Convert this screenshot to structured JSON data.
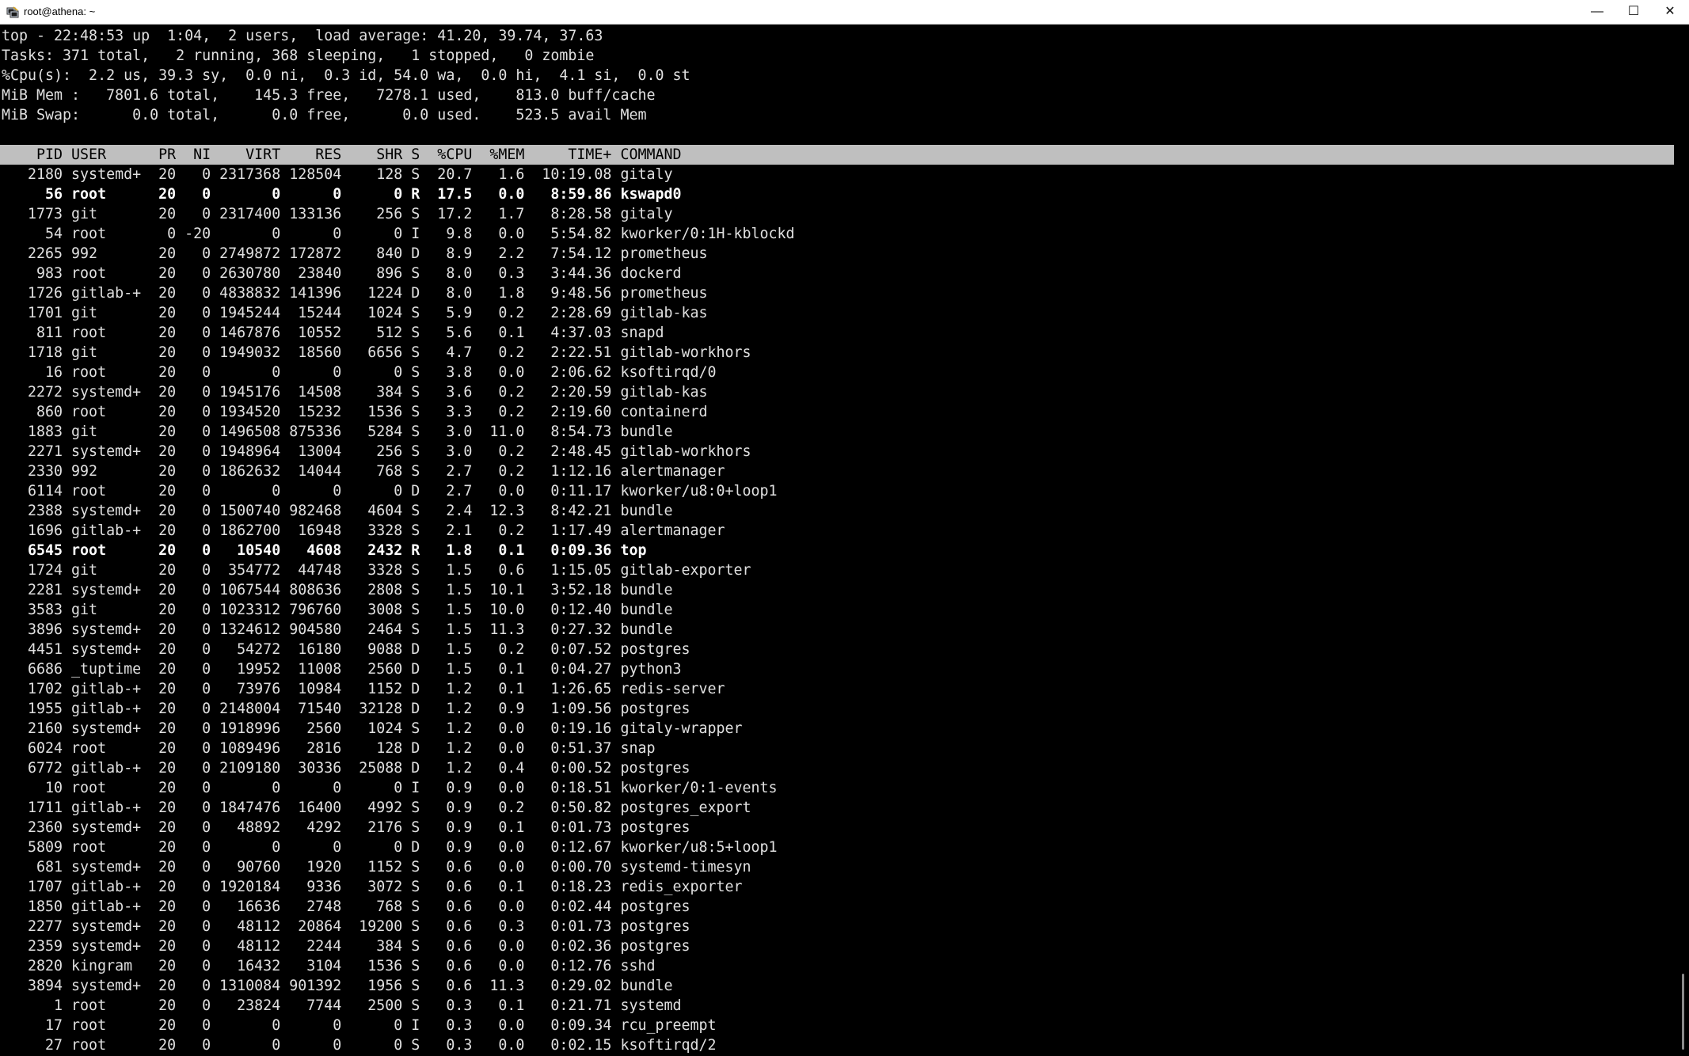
{
  "window": {
    "title": "root@athena: ~",
    "app_icon": "putty-terminal-icon",
    "controls": {
      "minimize": "—",
      "maximize": "☐",
      "close": "✕"
    }
  },
  "summary": [
    "top - 22:48:53 up  1:04,  2 users,  load average: 41.20, 39.74, 37.63",
    "Tasks: 371 total,   2 running, 368 sleeping,   1 stopped,   0 zombie",
    "%Cpu(s):  2.2 us, 39.3 sy,  0.0 ni,  0.3 id, 54.0 wa,  0.0 hi,  4.1 si,  0.0 st",
    "MiB Mem :   7801.6 total,    145.3 free,   7278.1 used,    813.0 buff/cache",
    "MiB Swap:      0.0 total,      0.0 free,      0.0 used.    523.5 avail Mem"
  ],
  "columns": [
    "PID",
    "USER",
    "PR",
    "NI",
    "VIRT",
    "RES",
    "SHR",
    "S",
    "%CPU",
    "%MEM",
    "TIME+",
    "COMMAND"
  ],
  "processes": [
    {
      "pid": "2180",
      "user": "systemd+",
      "pr": "20",
      "ni": "0",
      "virt": "2317368",
      "res": "128504",
      "shr": "128",
      "s": "S",
      "cpu": "20.7",
      "mem": "1.6",
      "time": "10:19.08",
      "cmd": "gitaly",
      "bold": false
    },
    {
      "pid": "56",
      "user": "root",
      "pr": "20",
      "ni": "0",
      "virt": "0",
      "res": "0",
      "shr": "0",
      "s": "R",
      "cpu": "17.5",
      "mem": "0.0",
      "time": "8:59.86",
      "cmd": "kswapd0",
      "bold": true
    },
    {
      "pid": "1773",
      "user": "git",
      "pr": "20",
      "ni": "0",
      "virt": "2317400",
      "res": "133136",
      "shr": "256",
      "s": "S",
      "cpu": "17.2",
      "mem": "1.7",
      "time": "8:28.58",
      "cmd": "gitaly",
      "bold": false
    },
    {
      "pid": "54",
      "user": "root",
      "pr": "0",
      "ni": "-20",
      "virt": "0",
      "res": "0",
      "shr": "0",
      "s": "I",
      "cpu": "9.8",
      "mem": "0.0",
      "time": "5:54.82",
      "cmd": "kworker/0:1H-kblockd",
      "bold": false
    },
    {
      "pid": "2265",
      "user": "992",
      "pr": "20",
      "ni": "0",
      "virt": "2749872",
      "res": "172872",
      "shr": "840",
      "s": "D",
      "cpu": "8.9",
      "mem": "2.2",
      "time": "7:54.12",
      "cmd": "prometheus",
      "bold": false
    },
    {
      "pid": "983",
      "user": "root",
      "pr": "20",
      "ni": "0",
      "virt": "2630780",
      "res": "23840",
      "shr": "896",
      "s": "S",
      "cpu": "8.0",
      "mem": "0.3",
      "time": "3:44.36",
      "cmd": "dockerd",
      "bold": false
    },
    {
      "pid": "1726",
      "user": "gitlab-+",
      "pr": "20",
      "ni": "0",
      "virt": "4838832",
      "res": "141396",
      "shr": "1224",
      "s": "D",
      "cpu": "8.0",
      "mem": "1.8",
      "time": "9:48.56",
      "cmd": "prometheus",
      "bold": false
    },
    {
      "pid": "1701",
      "user": "git",
      "pr": "20",
      "ni": "0",
      "virt": "1945244",
      "res": "15244",
      "shr": "1024",
      "s": "S",
      "cpu": "5.9",
      "mem": "0.2",
      "time": "2:28.69",
      "cmd": "gitlab-kas",
      "bold": false
    },
    {
      "pid": "811",
      "user": "root",
      "pr": "20",
      "ni": "0",
      "virt": "1467876",
      "res": "10552",
      "shr": "512",
      "s": "S",
      "cpu": "5.6",
      "mem": "0.1",
      "time": "4:37.03",
      "cmd": "snapd",
      "bold": false
    },
    {
      "pid": "1718",
      "user": "git",
      "pr": "20",
      "ni": "0",
      "virt": "1949032",
      "res": "18560",
      "shr": "6656",
      "s": "S",
      "cpu": "4.7",
      "mem": "0.2",
      "time": "2:22.51",
      "cmd": "gitlab-workhors",
      "bold": false
    },
    {
      "pid": "16",
      "user": "root",
      "pr": "20",
      "ni": "0",
      "virt": "0",
      "res": "0",
      "shr": "0",
      "s": "S",
      "cpu": "3.8",
      "mem": "0.0",
      "time": "2:06.62",
      "cmd": "ksoftirqd/0",
      "bold": false
    },
    {
      "pid": "2272",
      "user": "systemd+",
      "pr": "20",
      "ni": "0",
      "virt": "1945176",
      "res": "14508",
      "shr": "384",
      "s": "S",
      "cpu": "3.6",
      "mem": "0.2",
      "time": "2:20.59",
      "cmd": "gitlab-kas",
      "bold": false
    },
    {
      "pid": "860",
      "user": "root",
      "pr": "20",
      "ni": "0",
      "virt": "1934520",
      "res": "15232",
      "shr": "1536",
      "s": "S",
      "cpu": "3.3",
      "mem": "0.2",
      "time": "2:19.60",
      "cmd": "containerd",
      "bold": false
    },
    {
      "pid": "1883",
      "user": "git",
      "pr": "20",
      "ni": "0",
      "virt": "1496508",
      "res": "875336",
      "shr": "5284",
      "s": "S",
      "cpu": "3.0",
      "mem": "11.0",
      "time": "8:54.73",
      "cmd": "bundle",
      "bold": false
    },
    {
      "pid": "2271",
      "user": "systemd+",
      "pr": "20",
      "ni": "0",
      "virt": "1948964",
      "res": "13004",
      "shr": "256",
      "s": "S",
      "cpu": "3.0",
      "mem": "0.2",
      "time": "2:48.45",
      "cmd": "gitlab-workhors",
      "bold": false
    },
    {
      "pid": "2330",
      "user": "992",
      "pr": "20",
      "ni": "0",
      "virt": "1862632",
      "res": "14044",
      "shr": "768",
      "s": "S",
      "cpu": "2.7",
      "mem": "0.2",
      "time": "1:12.16",
      "cmd": "alertmanager",
      "bold": false
    },
    {
      "pid": "6114",
      "user": "root",
      "pr": "20",
      "ni": "0",
      "virt": "0",
      "res": "0",
      "shr": "0",
      "s": "D",
      "cpu": "2.7",
      "mem": "0.0",
      "time": "0:11.17",
      "cmd": "kworker/u8:0+loop1",
      "bold": false
    },
    {
      "pid": "2388",
      "user": "systemd+",
      "pr": "20",
      "ni": "0",
      "virt": "1500740",
      "res": "982468",
      "shr": "4604",
      "s": "S",
      "cpu": "2.4",
      "mem": "12.3",
      "time": "8:42.21",
      "cmd": "bundle",
      "bold": false
    },
    {
      "pid": "1696",
      "user": "gitlab-+",
      "pr": "20",
      "ni": "0",
      "virt": "1862700",
      "res": "16948",
      "shr": "3328",
      "s": "S",
      "cpu": "2.1",
      "mem": "0.2",
      "time": "1:17.49",
      "cmd": "alertmanager",
      "bold": false
    },
    {
      "pid": "6545",
      "user": "root",
      "pr": "20",
      "ni": "0",
      "virt": "10540",
      "res": "4608",
      "shr": "2432",
      "s": "R",
      "cpu": "1.8",
      "mem": "0.1",
      "time": "0:09.36",
      "cmd": "top",
      "bold": true
    },
    {
      "pid": "1724",
      "user": "git",
      "pr": "20",
      "ni": "0",
      "virt": "354772",
      "res": "44748",
      "shr": "3328",
      "s": "S",
      "cpu": "1.5",
      "mem": "0.6",
      "time": "1:15.05",
      "cmd": "gitlab-exporter",
      "bold": false
    },
    {
      "pid": "2281",
      "user": "systemd+",
      "pr": "20",
      "ni": "0",
      "virt": "1067544",
      "res": "808636",
      "shr": "2808",
      "s": "S",
      "cpu": "1.5",
      "mem": "10.1",
      "time": "3:52.18",
      "cmd": "bundle",
      "bold": false
    },
    {
      "pid": "3583",
      "user": "git",
      "pr": "20",
      "ni": "0",
      "virt": "1023312",
      "res": "796760",
      "shr": "3008",
      "s": "S",
      "cpu": "1.5",
      "mem": "10.0",
      "time": "0:12.40",
      "cmd": "bundle",
      "bold": false
    },
    {
      "pid": "3896",
      "user": "systemd+",
      "pr": "20",
      "ni": "0",
      "virt": "1324612",
      "res": "904580",
      "shr": "2464",
      "s": "S",
      "cpu": "1.5",
      "mem": "11.3",
      "time": "0:27.32",
      "cmd": "bundle",
      "bold": false
    },
    {
      "pid": "4451",
      "user": "systemd+",
      "pr": "20",
      "ni": "0",
      "virt": "54272",
      "res": "16180",
      "shr": "9088",
      "s": "D",
      "cpu": "1.5",
      "mem": "0.2",
      "time": "0:07.52",
      "cmd": "postgres",
      "bold": false
    },
    {
      "pid": "6686",
      "user": "_tuptime",
      "pr": "20",
      "ni": "0",
      "virt": "19952",
      "res": "11008",
      "shr": "2560",
      "s": "D",
      "cpu": "1.5",
      "mem": "0.1",
      "time": "0:04.27",
      "cmd": "python3",
      "bold": false
    },
    {
      "pid": "1702",
      "user": "gitlab-+",
      "pr": "20",
      "ni": "0",
      "virt": "73976",
      "res": "10984",
      "shr": "1152",
      "s": "D",
      "cpu": "1.2",
      "mem": "0.1",
      "time": "1:26.65",
      "cmd": "redis-server",
      "bold": false
    },
    {
      "pid": "1955",
      "user": "gitlab-+",
      "pr": "20",
      "ni": "0",
      "virt": "2148004",
      "res": "71540",
      "shr": "32128",
      "s": "D",
      "cpu": "1.2",
      "mem": "0.9",
      "time": "1:09.56",
      "cmd": "postgres",
      "bold": false
    },
    {
      "pid": "2160",
      "user": "systemd+",
      "pr": "20",
      "ni": "0",
      "virt": "1918996",
      "res": "2560",
      "shr": "1024",
      "s": "S",
      "cpu": "1.2",
      "mem": "0.0",
      "time": "0:19.16",
      "cmd": "gitaly-wrapper",
      "bold": false
    },
    {
      "pid": "6024",
      "user": "root",
      "pr": "20",
      "ni": "0",
      "virt": "1089496",
      "res": "2816",
      "shr": "128",
      "s": "D",
      "cpu": "1.2",
      "mem": "0.0",
      "time": "0:51.37",
      "cmd": "snap",
      "bold": false
    },
    {
      "pid": "6772",
      "user": "gitlab-+",
      "pr": "20",
      "ni": "0",
      "virt": "2109180",
      "res": "30336",
      "shr": "25088",
      "s": "D",
      "cpu": "1.2",
      "mem": "0.4",
      "time": "0:00.52",
      "cmd": "postgres",
      "bold": false
    },
    {
      "pid": "10",
      "user": "root",
      "pr": "20",
      "ni": "0",
      "virt": "0",
      "res": "0",
      "shr": "0",
      "s": "I",
      "cpu": "0.9",
      "mem": "0.0",
      "time": "0:18.51",
      "cmd": "kworker/0:1-events",
      "bold": false
    },
    {
      "pid": "1711",
      "user": "gitlab-+",
      "pr": "20",
      "ni": "0",
      "virt": "1847476",
      "res": "16400",
      "shr": "4992",
      "s": "S",
      "cpu": "0.9",
      "mem": "0.2",
      "time": "0:50.82",
      "cmd": "postgres_export",
      "bold": false
    },
    {
      "pid": "2360",
      "user": "systemd+",
      "pr": "20",
      "ni": "0",
      "virt": "48892",
      "res": "4292",
      "shr": "2176",
      "s": "S",
      "cpu": "0.9",
      "mem": "0.1",
      "time": "0:01.73",
      "cmd": "postgres",
      "bold": false
    },
    {
      "pid": "5809",
      "user": "root",
      "pr": "20",
      "ni": "0",
      "virt": "0",
      "res": "0",
      "shr": "0",
      "s": "D",
      "cpu": "0.9",
      "mem": "0.0",
      "time": "0:12.67",
      "cmd": "kworker/u8:5+loop1",
      "bold": false
    },
    {
      "pid": "681",
      "user": "systemd+",
      "pr": "20",
      "ni": "0",
      "virt": "90760",
      "res": "1920",
      "shr": "1152",
      "s": "S",
      "cpu": "0.6",
      "mem": "0.0",
      "time": "0:00.70",
      "cmd": "systemd-timesyn",
      "bold": false
    },
    {
      "pid": "1707",
      "user": "gitlab-+",
      "pr": "20",
      "ni": "0",
      "virt": "1920184",
      "res": "9336",
      "shr": "3072",
      "s": "S",
      "cpu": "0.6",
      "mem": "0.1",
      "time": "0:18.23",
      "cmd": "redis_exporter",
      "bold": false
    },
    {
      "pid": "1850",
      "user": "gitlab-+",
      "pr": "20",
      "ni": "0",
      "virt": "16636",
      "res": "2748",
      "shr": "768",
      "s": "S",
      "cpu": "0.6",
      "mem": "0.0",
      "time": "0:02.44",
      "cmd": "postgres",
      "bold": false
    },
    {
      "pid": "2277",
      "user": "systemd+",
      "pr": "20",
      "ni": "0",
      "virt": "48112",
      "res": "20864",
      "shr": "19200",
      "s": "S",
      "cpu": "0.6",
      "mem": "0.3",
      "time": "0:01.73",
      "cmd": "postgres",
      "bold": false
    },
    {
      "pid": "2359",
      "user": "systemd+",
      "pr": "20",
      "ni": "0",
      "virt": "48112",
      "res": "2244",
      "shr": "384",
      "s": "S",
      "cpu": "0.6",
      "mem": "0.0",
      "time": "0:02.36",
      "cmd": "postgres",
      "bold": false
    },
    {
      "pid": "2820",
      "user": "kingram",
      "pr": "20",
      "ni": "0",
      "virt": "16432",
      "res": "3104",
      "shr": "1536",
      "s": "S",
      "cpu": "0.6",
      "mem": "0.0",
      "time": "0:12.76",
      "cmd": "sshd",
      "bold": false
    },
    {
      "pid": "3894",
      "user": "systemd+",
      "pr": "20",
      "ni": "0",
      "virt": "1310084",
      "res": "901392",
      "shr": "1956",
      "s": "S",
      "cpu": "0.6",
      "mem": "11.3",
      "time": "0:29.02",
      "cmd": "bundle",
      "bold": false
    },
    {
      "pid": "1",
      "user": "root",
      "pr": "20",
      "ni": "0",
      "virt": "23824",
      "res": "7744",
      "shr": "2500",
      "s": "S",
      "cpu": "0.3",
      "mem": "0.1",
      "time": "0:21.71",
      "cmd": "systemd",
      "bold": false
    },
    {
      "pid": "17",
      "user": "root",
      "pr": "20",
      "ni": "0",
      "virt": "0",
      "res": "0",
      "shr": "0",
      "s": "I",
      "cpu": "0.3",
      "mem": "0.0",
      "time": "0:09.34",
      "cmd": "rcu_preempt",
      "bold": false
    },
    {
      "pid": "27",
      "user": "root",
      "pr": "20",
      "ni": "0",
      "virt": "0",
      "res": "0",
      "shr": "0",
      "s": "S",
      "cpu": "0.3",
      "mem": "0.0",
      "time": "0:02.15",
      "cmd": "ksoftirqd/2",
      "bold": false
    }
  ]
}
